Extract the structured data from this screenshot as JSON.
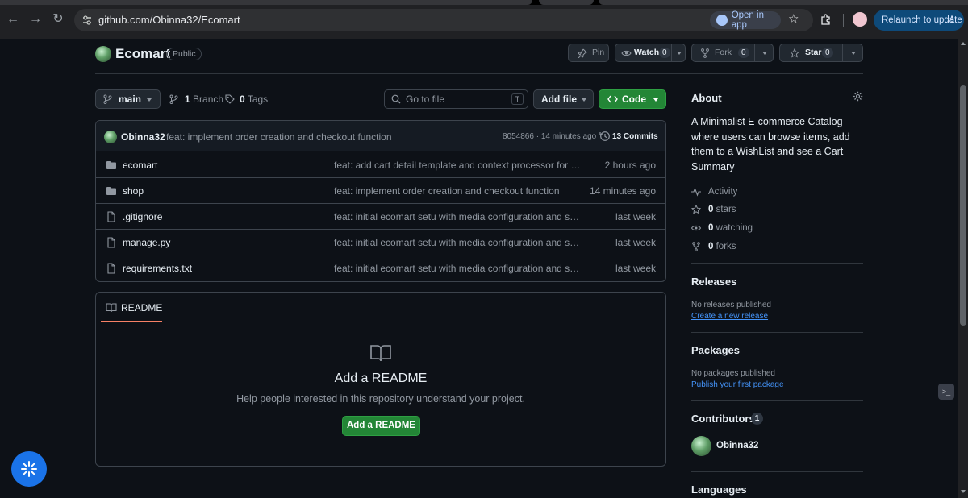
{
  "browser": {
    "url": "github.com/Obinna32/Ecomart",
    "open_in_app": "Open in app",
    "relaunch": "Relaunch to update",
    "menu_dots": "⋮",
    "back_glyph": "←",
    "forward_glyph": "→",
    "reload_glyph": "↻",
    "bookmark_glyph": "☆"
  },
  "repo": {
    "name": "Ecomart",
    "visibility": "Public",
    "pin_label": "Pin",
    "watch_label": "Watch",
    "watch_count": "0",
    "fork_label": "Fork",
    "fork_count": "0",
    "star_label": "Star",
    "star_count": "0"
  },
  "toolbar": {
    "branch": "main",
    "branches_count": "1",
    "branches_label": "Branch",
    "tags_count": "0",
    "tags_label": "Tags",
    "go_to_file_placeholder": "Go to file",
    "go_to_file_kbd": "T",
    "add_file": "Add file",
    "code": "Code"
  },
  "latest_commit": {
    "author": "Obinna32",
    "message": "feat: implement order creation and checkout function",
    "sha_time": "8054866 · 14 minutes ago",
    "commits": "13 Commits"
  },
  "files": [
    {
      "type": "folder",
      "name": "ecomart",
      "message": "feat: add cart detail template and context processor for globa...",
      "date": "2 hours ago"
    },
    {
      "type": "folder",
      "name": "shop",
      "message": "feat: implement order creation and checkout function",
      "date": "14 minutes ago"
    },
    {
      "type": "file",
      "name": ".gitignore",
      "message": "feat: initial ecomart setu with media configuration and shop a...",
      "date": "last week"
    },
    {
      "type": "file",
      "name": "manage.py",
      "message": "feat: initial ecomart setu with media configuration and shop a...",
      "date": "last week"
    },
    {
      "type": "file",
      "name": "requirements.txt",
      "message": "feat: initial ecomart setu with media configuration and shop a...",
      "date": "last week"
    }
  ],
  "readme": {
    "tab": "README",
    "heading": "Add a README",
    "text": "Help people interested in this repository understand your project.",
    "button": "Add a README"
  },
  "sidebar": {
    "about_title": "About",
    "about_desc": "A Minimalist E-commerce Catalog where users can browse items, add them to a WishList and see a Cart Summary",
    "activity": "Activity",
    "stars_count": "0",
    "stars_label": "stars",
    "watching_count": "0",
    "watching_label": "watching",
    "forks_count": "0",
    "forks_label": "forks",
    "releases_title": "Releases",
    "releases_none": "No releases published",
    "releases_link": "Create a new release",
    "packages_title": "Packages",
    "packages_none": "No packages published",
    "packages_link": "Publish your first package",
    "contributors_title": "Contributors",
    "contributors_count": "1",
    "contributor_name": "Obinna32",
    "languages_title": "Languages"
  },
  "colors": {
    "accent_green": "#238636",
    "link_blue": "#4493f8",
    "tab_underline": "#f78166"
  },
  "icons": [
    "search-icon",
    "branch-icon",
    "tag-icon",
    "history-icon",
    "folder-icon",
    "file-icon",
    "book-icon",
    "gear-icon",
    "pulse-icon",
    "star-icon",
    "eye-icon",
    "fork-icon",
    "pin-icon"
  ]
}
